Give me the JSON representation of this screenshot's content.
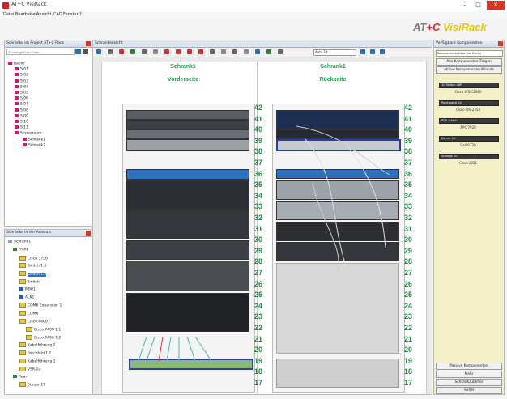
{
  "window": {
    "title": "AT+C VisiRack",
    "min_glyph": "–",
    "max_glyph": "□",
    "close_glyph": "✕"
  },
  "menu": [
    "Datei",
    "Bearbeiten",
    "Ansicht",
    "CAD",
    "Fenster",
    "?"
  ],
  "logo": {
    "left": "AT",
    "accent": "+C",
    "brand": "VisiRack"
  },
  "tree_panel": {
    "header": "Schränke im Projekt AT+C Rack",
    "search_placeholder": "Suchbegriff hier Enter",
    "root": "Raum",
    "items": [
      "S 01",
      "S 02",
      "S 03",
      "S 04",
      "S 05",
      "S 06",
      "S 07",
      "S 08",
      "S 09",
      "S 10",
      "S 11",
      "Serverraum",
      "Schrank1",
      "Schrank2"
    ]
  },
  "module_panel": {
    "header": "Schränke in der Auswahl",
    "items": [
      "Schrank1",
      "Front",
      "Cisco 3750",
      "Switch 1.1",
      "Switch 1.2",
      "Switch",
      "MB01",
      "ALK1",
      "COM6 Expansion 1",
      "COM6",
      "Cisco P400",
      "Cisco P400 1.1",
      "Cisco P400 1.2",
      "Kabelführung 2",
      "Patchfeld 1.1",
      "Kabelführung 1",
      "VSR-1u",
      "Rear",
      "Steuer-17"
    ]
  },
  "rack_view": {
    "header": "Schrankansicht",
    "zoom_value": "Auto Fit",
    "front_title": "Schrank1",
    "front_subtitle": "Vorderseite",
    "rear_title": "Schrank1",
    "rear_subtitle": "Rückseite",
    "units": [
      "42",
      "41",
      "40",
      "39",
      "38",
      "37",
      "36",
      "35",
      "34",
      "33",
      "32",
      "31",
      "30",
      "29",
      "28",
      "27",
      "26",
      "25",
      "24",
      "23",
      "22",
      "21",
      "20",
      "19",
      "18",
      "17"
    ]
  },
  "right_panel": {
    "header": "Verfügbare Komponenten",
    "dropdown": "Komponentenliste der Racks",
    "btn_all": "Alle Komponenten Zeigen",
    "btn_active": "Aktive Komponenten Module",
    "components": [
      {
        "bar": "1U Switch 48P",
        "label": "Cisco WS-C2960"
      },
      {
        "bar": "Patchpanel 24",
        "label": "Cisco WS-2350"
      },
      {
        "bar": "PDU 8-fach",
        "label": "APC 7920"
      },
      {
        "bar": "Server 2U",
        "label": "Dell R720"
      },
      {
        "bar": "Storage 2U",
        "label": "Cisco 2921"
      }
    ],
    "bottom_buttons": [
      "Passive Komponenten",
      "Mehr",
      "Schrankzubehör",
      "Seitel"
    ]
  },
  "colors": {
    "accent": "#d32f2f",
    "unit_green": "#1b8a3d",
    "header_green": "#1e9d4a",
    "selection": "#2a6fc9"
  }
}
